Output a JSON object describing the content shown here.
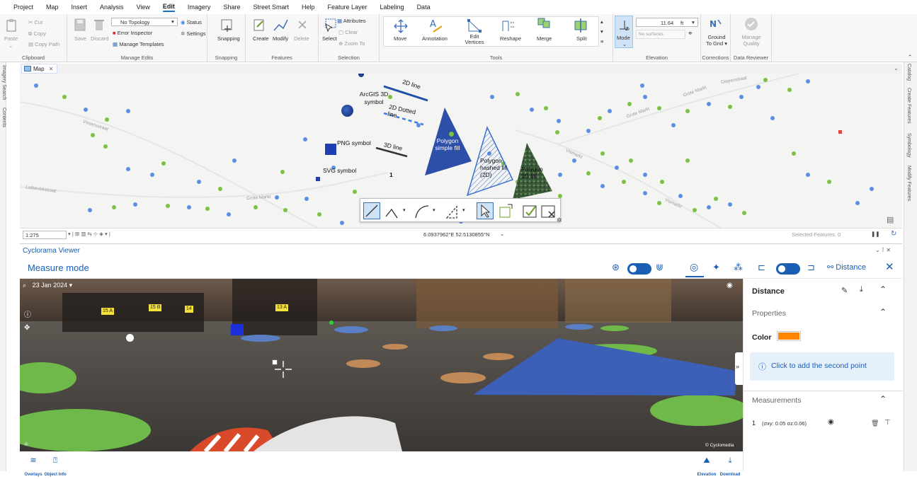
{
  "menu_tabs": [
    "Project",
    "Map",
    "Insert",
    "Analysis",
    "View",
    "Edit",
    "Imagery",
    "Share",
    "Street Smart",
    "Help",
    "Feature Layer",
    "Labeling",
    "Data"
  ],
  "active_tab": "Edit",
  "ribbon": {
    "clipboard": {
      "paste": "Paste",
      "cut": "Cut",
      "copy": "Copy",
      "copy_path": "Copy Path",
      "group": "Clipboard"
    },
    "manage_edits": {
      "save": "Save",
      "discard": "Discard",
      "topology": "No Topology",
      "error_inspector": "Error Inspector",
      "manage_templates": "Manage Templates",
      "status": "Status",
      "settings": "Settings",
      "group": "Manage Edits"
    },
    "snapping": {
      "snapping": "Snapping",
      "group": "Snapping"
    },
    "features": {
      "create": "Create",
      "modify": "Modify",
      "delete": "Delete",
      "group": "Features"
    },
    "selection": {
      "select": "Select",
      "attributes": "Attributes",
      "clear": "Clear",
      "zoom_to": "Zoom To",
      "group": "Selection"
    },
    "tools": {
      "move": "Move",
      "annotation": "Annotation",
      "edit_vertices": "Edit Vertices",
      "reshape": "Reshape",
      "merge": "Merge",
      "split": "Split",
      "group": "Tools"
    },
    "elevation": {
      "mode": "Mode",
      "value": "11.64",
      "unit": "ft",
      "surfaces": "No surfaces",
      "group": "Elevation"
    },
    "corrections": {
      "ground_to_grid": "Ground To Grid",
      "manage_quality": "Manage Quality",
      "corrections_group": "Corrections",
      "reviewer_group": "Data Reviewer"
    }
  },
  "left_dock": [
    "Imagery Search",
    "Contents"
  ],
  "right_dock": [
    "Catalog",
    "Create Features",
    "Symbology",
    "Modify Features"
  ],
  "map": {
    "tab_label": "Map",
    "labels": {
      "line2d": "2D line",
      "arcgis3d": "ArcGIS 3D symbol",
      "dotted": "2D Dotted line",
      "png": "PNG symbol",
      "line3d": "3D line",
      "svg": "SVG symbol",
      "poly_simple": "Polygon simple fill",
      "poly_hashed": "Polygon hashed fill (2D)",
      "poly_3d": "Polygon 3D fill",
      "number": "1"
    },
    "streets": [
      "Grote Markt",
      "Vismarkt",
      "Vissersstraat",
      "Lutkeviskstraat",
      "Diepenstraat"
    ],
    "scale": "1:275",
    "coordinates": "6.0937962°E 52.5130855°N",
    "selected_features": "Selected Features: 0"
  },
  "cyclorama": {
    "title": "Cyclorama Viewer",
    "mode": "Measure mode",
    "distance_label": "Distance",
    "date": "23 Jan 2024",
    "copyright": "© Cyclomedia",
    "signs": [
      "15 A",
      "15 B",
      "14",
      "13 A"
    ],
    "overlays": "Overlays",
    "object_info": "Object Info",
    "elevation": "Elevation",
    "download": "Download"
  },
  "panel": {
    "title": "Distance",
    "properties": "Properties",
    "color_label": "Color",
    "color": "#ff8400",
    "hint": "Click to add the second point",
    "measurements": "Measurements",
    "row_index": "1",
    "row_value": "(σxy: 0.05 σz:0.06)"
  }
}
